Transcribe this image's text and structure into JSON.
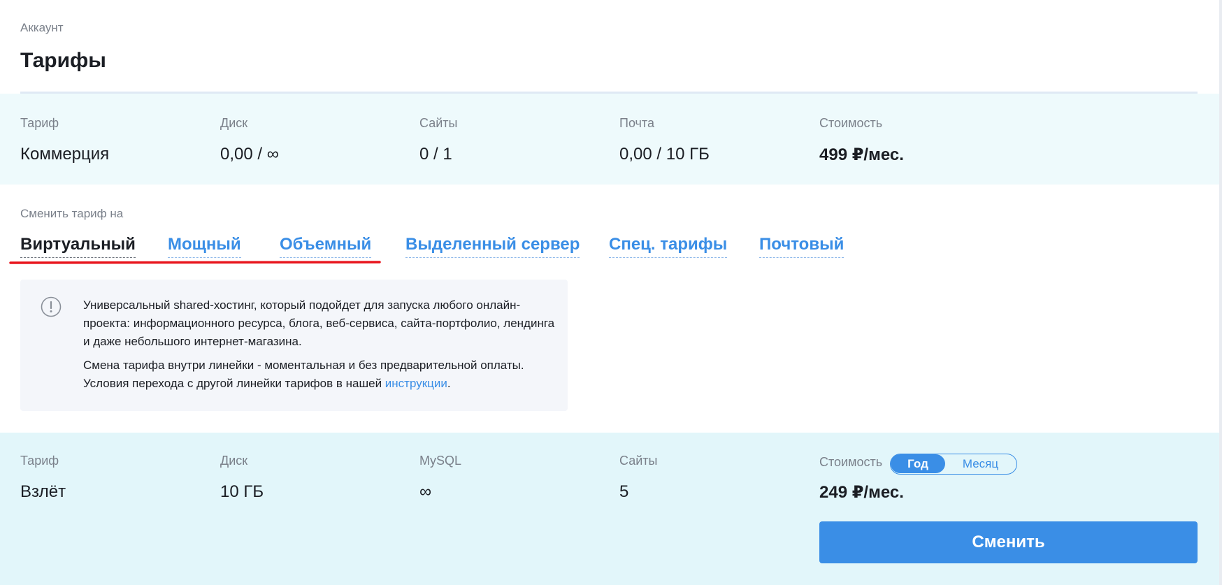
{
  "header": {
    "breadcrumb": "Аккаунт",
    "title": "Тарифы"
  },
  "current_tariff": {
    "tariff_label": "Тариф",
    "tariff_value": "Коммерция",
    "disk_label": "Диск",
    "disk_value": "0,00 / ∞",
    "sites_label": "Сайты",
    "sites_value": "0 / 1",
    "mail_label": "Почта",
    "mail_value": "0,00 / 10 ГБ",
    "cost_label": "Стоимость",
    "cost_value": "499 ₽/мес."
  },
  "change": {
    "label": "Сменить тариф на",
    "tabs": [
      {
        "label": "Виртуальный",
        "active": true
      },
      {
        "label": "Мощный",
        "active": false
      },
      {
        "label": "Объемный",
        "active": false
      },
      {
        "label": "Выделенный сервер",
        "active": false
      },
      {
        "label": "Спец. тарифы",
        "active": false
      },
      {
        "label": "Почтовый",
        "active": false
      }
    ],
    "annotation_color": "#e8141c"
  },
  "info": {
    "icon": "exclamation-circle-icon",
    "paragraph1": "Универсальный shared-хостинг, который подойдет для запуска любого онлайн-проекта: информационного ресурса, блога, веб-сервиса, сайта-портфолио, лендинга и даже небольшого интернет-магазина.",
    "paragraph2_line1": "Смена тарифа внутри линейки - моментальная и без предварительной оплаты.",
    "paragraph2_line2": "Условия перехода с другой линейки тарифов в нашей ",
    "link": "инструкции",
    "paragraph2_end": "."
  },
  "plan": {
    "tariff_label": "Тариф",
    "tariff_value": "Взлёт",
    "disk_label": "Диск",
    "disk_value": "10 ГБ",
    "mysql_label": "MySQL",
    "mysql_value": "∞",
    "sites_label": "Сайты",
    "sites_value": "5",
    "cost_label": "Стоимость",
    "period_options": [
      "Год",
      "Месяц"
    ],
    "period_selected": "Год",
    "cost_value": "249 ₽/мес.",
    "button_label": "Сменить"
  },
  "colors": {
    "accent": "#3a8ee6",
    "current_band": "#eefafc",
    "plan_band": "#e2f6fa",
    "info_box": "#f4f6fa"
  }
}
